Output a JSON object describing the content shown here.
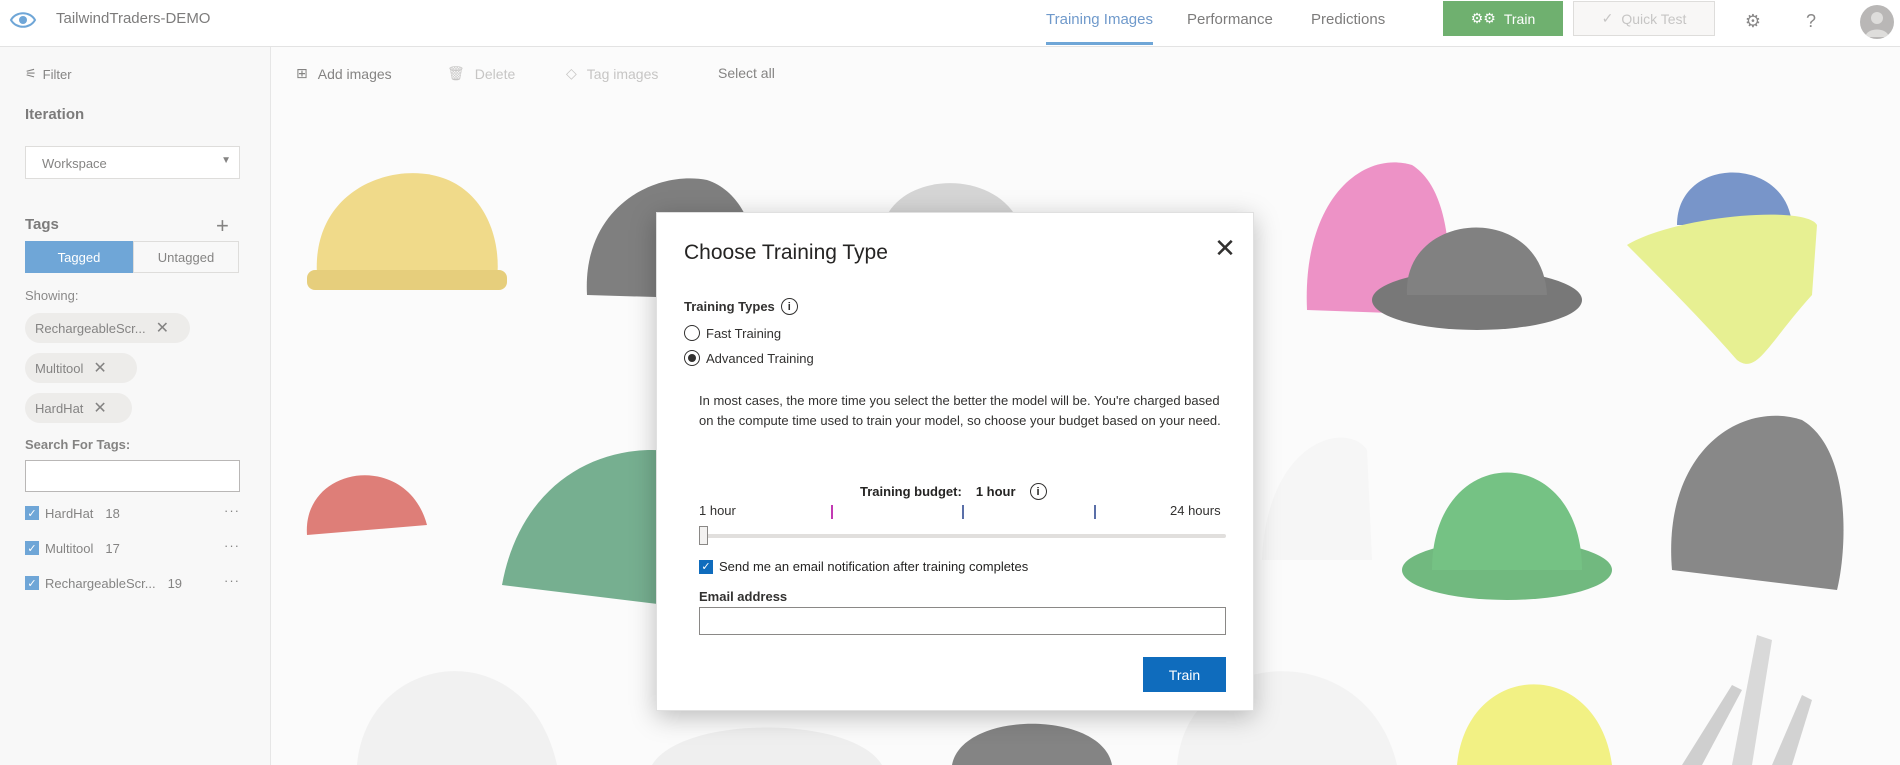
{
  "header": {
    "project_name": "TailwindTraders-DEMO",
    "tabs": [
      "Training Images",
      "Performance",
      "Predictions"
    ],
    "active_tab": "Training Images",
    "train_label": "Train",
    "quick_test_label": "Quick Test",
    "accent_color": "#0f6cbd",
    "train_color": "#107c10"
  },
  "sidebar": {
    "filter_label": "Filter",
    "iteration_title": "Iteration",
    "iteration_value": "Workspace",
    "tags_title": "Tags",
    "tagged_label": "Tagged",
    "untagged_label": "Untagged",
    "showing_label": "Showing:",
    "chips": [
      "RechargeableScr...",
      "Multitool",
      "HardHat"
    ],
    "search_label": "Search For Tags:",
    "search_value": "",
    "tags": [
      {
        "name": "HardHat",
        "count": "18",
        "checked": true
      },
      {
        "name": "Multitool",
        "count": "17",
        "checked": true
      },
      {
        "name": "RechargeableScr...",
        "count": "19",
        "checked": true
      }
    ]
  },
  "toolbar": {
    "add_images": "Add images",
    "delete": "Delete",
    "tag_images": "Tag images",
    "select_all": "Select all"
  },
  "modal": {
    "title": "Choose Training Type",
    "types_label": "Training Types",
    "options": [
      {
        "label": "Fast Training",
        "selected": false
      },
      {
        "label": "Advanced Training",
        "selected": true
      }
    ],
    "description": "In most cases, the more time you select the better the model will be. You're charged based on the compute time used to train your model, so choose your budget based on your need.",
    "budget_label": "Training budget:",
    "budget_value": "1 hour",
    "slider_min_label": "1 hour",
    "slider_max_label": "24 hours",
    "slider_fraction": 0,
    "email_checkbox_label": "Send me an email notification after training completes",
    "email_checkbox_checked": true,
    "email_label": "Email address",
    "email_value": "",
    "train_button": "Train"
  }
}
